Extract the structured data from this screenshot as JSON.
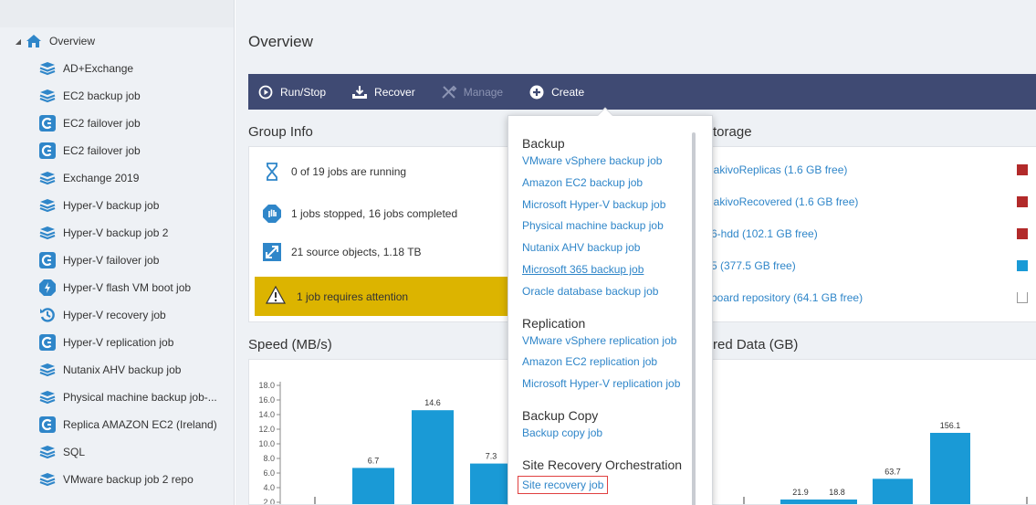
{
  "sidebar": {
    "root": {
      "label": "Overview",
      "icon": "home-icon"
    },
    "items": [
      {
        "label": "AD+Exchange",
        "icon": "backup-job-icon"
      },
      {
        "label": "EC2 backup job",
        "icon": "backup-job-icon"
      },
      {
        "label": "EC2 failover job",
        "icon": "failover-job-icon"
      },
      {
        "label": "EC2 failover job",
        "icon": "failover-job-icon"
      },
      {
        "label": "Exchange 2019",
        "icon": "backup-job-icon"
      },
      {
        "label": "Hyper-V backup job",
        "icon": "backup-job-icon"
      },
      {
        "label": "Hyper-V backup job 2",
        "icon": "backup-job-icon"
      },
      {
        "label": "Hyper-V failover job",
        "icon": "failover-job-icon"
      },
      {
        "label": "Hyper-V flash VM boot job",
        "icon": "flash-boot-icon"
      },
      {
        "label": "Hyper-V recovery job",
        "icon": "recovery-job-icon"
      },
      {
        "label": "Hyper-V replication job",
        "icon": "replication-job-icon"
      },
      {
        "label": "Nutanix AHV backup job",
        "icon": "backup-job-icon"
      },
      {
        "label": "Physical machine backup job-...",
        "icon": "backup-job-icon"
      },
      {
        "label": "Replica AMAZON EC2 (Ireland)",
        "icon": "replication-job-icon"
      },
      {
        "label": "SQL",
        "icon": "backup-job-icon"
      },
      {
        "label": "VMware backup job 2 repo",
        "icon": "backup-job-icon"
      }
    ]
  },
  "main": {
    "title": "Overview",
    "toolbar": {
      "run_stop": "Run/Stop",
      "recover": "Recover",
      "manage": "Manage",
      "create": "Create"
    },
    "group_info": {
      "title": "Group Info",
      "running": "0 of 19 jobs are running",
      "stopped": "1 jobs stopped, 16 jobs completed",
      "sources": "21 source objects, 1.18 TB",
      "attention": "1 job requires attention"
    },
    "storage": {
      "title": "torage",
      "rows": [
        {
          "label": "lakivoReplicas (1.6 GB free)",
          "color": "#b22a2a"
        },
        {
          "label": "lakivoRecovered (1.6 GB free)",
          "color": "#b22a2a"
        },
        {
          "label": "6-hdd (102.1 GB free)",
          "color": "#b22a2a"
        },
        {
          "label": "5 (377.5 GB free)",
          "color": "#1a9ad6"
        },
        {
          "label": "board repository (64.1 GB free)",
          "color": "#ffffff"
        }
      ]
    },
    "speed_title": "Speed (MB/s)",
    "stored_title": "red Data (GB)"
  },
  "create_menu": {
    "sections": [
      {
        "heading": "Backup",
        "items": [
          "VMware vSphere backup job",
          "Amazon EC2 backup job",
          "Microsoft Hyper-V backup job",
          "Physical machine backup job",
          "Nutanix AHV backup job",
          "Microsoft 365 backup job",
          "Oracle database backup job"
        ]
      },
      {
        "heading": "Replication",
        "items": [
          "VMware vSphere replication job",
          "Amazon EC2 replication job",
          "Microsoft Hyper-V replication job"
        ]
      },
      {
        "heading": "Backup Copy",
        "items": [
          "Backup copy job"
        ]
      },
      {
        "heading": "Site Recovery Orchestration",
        "items": [
          "Site recovery job"
        ]
      }
    ]
  },
  "chart_data": [
    {
      "type": "bar",
      "title": "Speed (MB/s)",
      "ylim": [
        0,
        18
      ],
      "yticks": [
        "18.0",
        "16.0",
        "14.0",
        "12.0",
        "10.0",
        "8.0",
        "6.0",
        "4.0",
        "2.0"
      ],
      "values": [
        0,
        6.7,
        14.6,
        7.3
      ],
      "labels": [
        "",
        "6.7",
        "14.6",
        "7.3"
      ],
      "color": "#1a9ad6"
    },
    {
      "type": "bar",
      "title": "red Data (GB)",
      "values": [
        0,
        21.9,
        18.8,
        63.7,
        156.1,
        0
      ],
      "labels": [
        "",
        "21.9",
        "18.8",
        "63.7",
        "156.1",
        ""
      ],
      "color": "#1a9ad6"
    }
  ]
}
